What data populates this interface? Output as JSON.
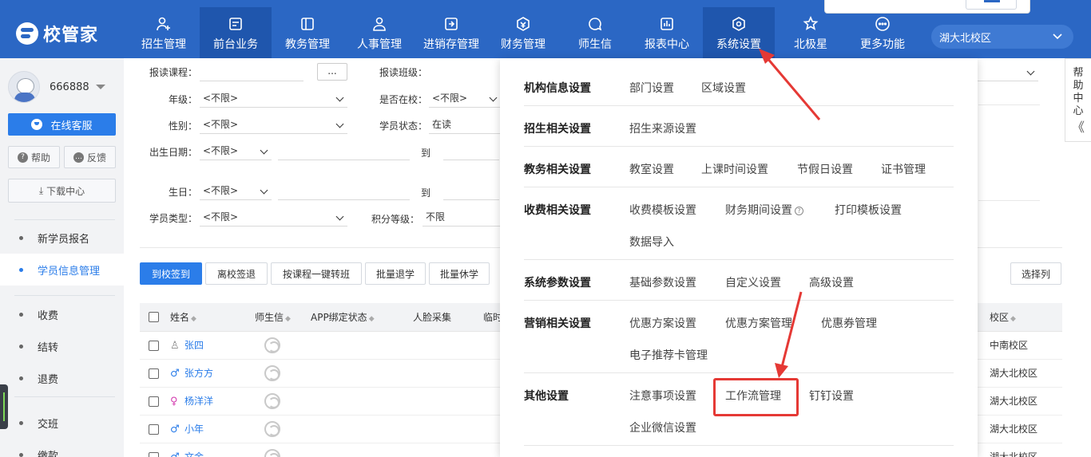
{
  "brand": {
    "name": "校管家"
  },
  "nav": [
    {
      "label": "招生管理",
      "icon": "user-plus-icon",
      "active": false
    },
    {
      "label": "前台业务",
      "icon": "front-desk-icon",
      "active": true
    },
    {
      "label": "教务管理",
      "icon": "book-icon",
      "active": false
    },
    {
      "label": "人事管理",
      "icon": "person-icon",
      "active": false
    },
    {
      "label": "进销存管理",
      "icon": "inventory-icon",
      "active": false
    },
    {
      "label": "财务管理",
      "icon": "finance-icon",
      "active": false
    },
    {
      "label": "师生信",
      "icon": "chat-icon",
      "active": false
    },
    {
      "label": "报表中心",
      "icon": "report-icon",
      "active": false
    },
    {
      "label": "系统设置",
      "icon": "settings-icon",
      "active": false
    },
    {
      "label": "北极星",
      "icon": "star-icon",
      "active": false
    },
    {
      "label": "更多功能",
      "icon": "more-icon",
      "active": false
    }
  ],
  "campus": {
    "selected": "湖大北校区"
  },
  "sidebar": {
    "username": "666888",
    "service_btn": "在线客服",
    "help_btn": "帮助",
    "feedback_btn": "反馈",
    "download_btn": "下载中心",
    "items": [
      {
        "label": "新学员报名",
        "active": false
      },
      {
        "label": "学员信息管理",
        "active": true
      },
      {
        "label": "收费",
        "active": false
      },
      {
        "label": "结转",
        "active": false
      },
      {
        "label": "退费",
        "active": false
      },
      {
        "label": "交班",
        "active": false
      },
      {
        "label": "缴款",
        "active": false
      }
    ]
  },
  "filters": {
    "course_label": "报读课程：",
    "course_btn": "...",
    "class_label": "报读班级：",
    "grade_label": "年级：",
    "grade_value": "<不限>",
    "atschool_label": "是否在校：",
    "atschool_value": "<不限>",
    "gender_label": "性别：",
    "gender_value": "<不限>",
    "status_label": "学员状态：",
    "status_value": "在读",
    "birthdate_label": "出生日期：",
    "birthdate_value": "<不限>",
    "to_label": "到",
    "birthday_label": "生日：",
    "birthday_value": "<不限>",
    "type_label": "学员类型：",
    "type_value": "<不限>",
    "points_label": "积分等级：",
    "points_value": "不限"
  },
  "actions": [
    "到校签到",
    "离校签退",
    "按课程一键转班",
    "批量退学",
    "批量休学"
  ],
  "select_columns_btn": "选择列",
  "table": {
    "headers": [
      "姓名",
      "师生信",
      "APP绑定状态",
      "人脸采集",
      "临时",
      "校区"
    ],
    "rows": [
      {
        "name": "张四",
        "gender": "n",
        "campus": "中南校区"
      },
      {
        "name": "张方方",
        "gender": "m",
        "campus": "湖大北校区"
      },
      {
        "name": "杨洋洋",
        "gender": "f",
        "campus": "湖大北校区"
      },
      {
        "name": "小年",
        "gender": "m",
        "campus": "湖大北校区"
      },
      {
        "name": "文金",
        "gender": "m",
        "campus": "湖大北校区"
      }
    ]
  },
  "help_tab": {
    "chars": [
      "帮",
      "助",
      "中",
      "心"
    ],
    "collapse": "《"
  },
  "mega_menu": {
    "sections": [
      {
        "title": "机构信息设置",
        "links": [
          "部门设置",
          "区域设置"
        ]
      },
      {
        "title": "招生相关设置",
        "links": [
          "招生来源设置"
        ]
      },
      {
        "title": "教务相关设置",
        "links": [
          "教室设置",
          "上课时间设置",
          "节假日设置",
          "证书管理"
        ]
      },
      {
        "title": "收费相关设置",
        "links": [
          "收费模板设置",
          "财务期间设置",
          "打印模板设置",
          "数据导入"
        ]
      },
      {
        "title": "系统参数设置",
        "links": [
          "基础参数设置",
          "自定义设置",
          "高级设置"
        ]
      },
      {
        "title": "营销相关设置",
        "links": [
          "优惠方案设置",
          "优惠方案管理",
          "优惠券管理",
          "电子推荐卡管理"
        ]
      },
      {
        "title": "其他设置",
        "links": [
          "注意事项设置",
          "工作流管理",
          "钉钉设置",
          "企业微信设置"
        ]
      }
    ]
  },
  "colors": {
    "topbar": "#2b67c4",
    "accent": "#2b7de9",
    "highlight": "#e53935"
  }
}
